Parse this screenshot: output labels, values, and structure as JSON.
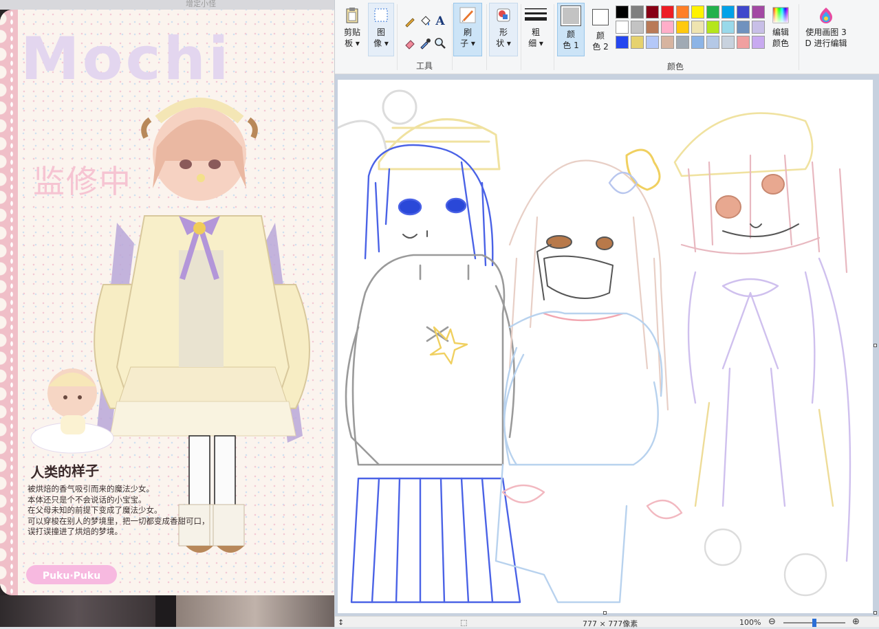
{
  "left_panel": {
    "top_text": "增定小怪",
    "logo": "Mochi",
    "watermark": "监修中",
    "desc_title": "人类的样子",
    "desc_lines": [
      "被烘焙的香气吸引而来的魔法少女。",
      "本体还只是个不会说话的小宝宝。",
      "在父母未知的前提下变成了魔法少女。",
      "可以穿梭在别人的梦境里，把一切都变成香甜可口，",
      "误打误撞进了烘焙的梦境。"
    ],
    "brand": "Puku·Puku"
  },
  "paint": {
    "clipboard": {
      "label": "剪贴",
      "label2": "板"
    },
    "image": {
      "label": "图",
      "label2": "像"
    },
    "tools_group": "工具",
    "brush": {
      "label": "刷",
      "label2": "子"
    },
    "shapes": {
      "label": "形",
      "label2": "状"
    },
    "size": {
      "label": "粗",
      "label2": "细"
    },
    "color1": {
      "label": "颜",
      "label2": "色 1"
    },
    "color2": {
      "label": "颜",
      "label2": "色 2"
    },
    "edit_colors": {
      "label": "编辑",
      "label2": "颜色"
    },
    "paint3d": {
      "label": "使用画图 3",
      "label2": "D 进行编辑"
    },
    "colors_group": "颜色",
    "palette_row1": [
      "#000000",
      "#7f7f7f",
      "#880015",
      "#ed1c24",
      "#ff7f27",
      "#fff200",
      "#22b14c",
      "#00a2e8",
      "#3f48cc",
      "#a349a4"
    ],
    "palette_row2": [
      "#ffffff",
      "#c3c3c3",
      "#b97a57",
      "#ffaec9",
      "#ffc90e",
      "#efe4b0",
      "#b5e61d",
      "#99d9ea",
      "#7092be",
      "#c8bfe7"
    ],
    "palette_row3": [
      "#2446f0",
      "#e6d26e",
      "#b4c8f8",
      "#d7b4a0",
      "#a0aab4",
      "#8cb4e6",
      "#b4c8e6",
      "#c8d2de",
      "#f0a0a0",
      "#c8aaf0"
    ],
    "color1_value": "#c3c3c3",
    "color2_value": "#ffffff",
    "status": {
      "pos": "↕",
      "sel": "⬚",
      "size": "777 × 777像素",
      "zoom": "100%"
    }
  }
}
